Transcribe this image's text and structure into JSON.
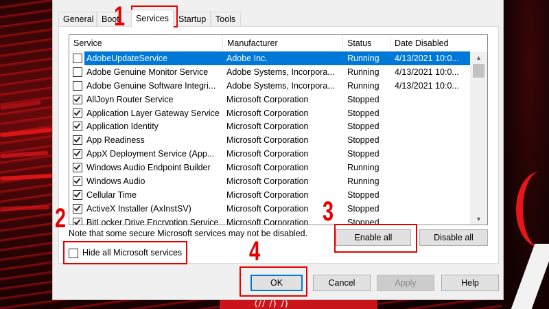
{
  "tabs": [
    {
      "label": "General"
    },
    {
      "label": "Boot"
    },
    {
      "label": "Services"
    },
    {
      "label": "Startup"
    },
    {
      "label": "Tools"
    }
  ],
  "columns": {
    "service": "Service",
    "manufacturer": "Manufacturer",
    "status": "Status",
    "date_disabled": "Date Disabled"
  },
  "services": [
    {
      "name": "AdobeUpdateService",
      "manufacturer": "Adobe Inc.",
      "status": "Running",
      "date": "4/13/2021 10:0...",
      "checked": false,
      "selected": true
    },
    {
      "name": "Adobe Genuine Monitor Service",
      "manufacturer": "Adobe Systems, Incorpora...",
      "status": "Running",
      "date": "4/13/2021 10:0...",
      "checked": false
    },
    {
      "name": "Adobe Genuine Software Integri...",
      "manufacturer": "Adobe Systems, Incorpora...",
      "status": "Running",
      "date": "4/13/2021 10:0...",
      "checked": false
    },
    {
      "name": "AllJoyn Router Service",
      "manufacturer": "Microsoft Corporation",
      "status": "Stopped",
      "date": "",
      "checked": true
    },
    {
      "name": "Application Layer Gateway Service",
      "manufacturer": "Microsoft Corporation",
      "status": "Stopped",
      "date": "",
      "checked": true
    },
    {
      "name": "Application Identity",
      "manufacturer": "Microsoft Corporation",
      "status": "Stopped",
      "date": "",
      "checked": true
    },
    {
      "name": "App Readiness",
      "manufacturer": "Microsoft Corporation",
      "status": "Stopped",
      "date": "",
      "checked": true
    },
    {
      "name": "AppX Deployment Service (App...",
      "manufacturer": "Microsoft Corporation",
      "status": "Stopped",
      "date": "",
      "checked": true
    },
    {
      "name": "Windows Audio Endpoint Builder",
      "manufacturer": "Microsoft Corporation",
      "status": "Running",
      "date": "",
      "checked": true
    },
    {
      "name": "Windows Audio",
      "manufacturer": "Microsoft Corporation",
      "status": "Running",
      "date": "",
      "checked": true
    },
    {
      "name": "Cellular Time",
      "manufacturer": "Microsoft Corporation",
      "status": "Stopped",
      "date": "",
      "checked": true
    },
    {
      "name": "ActiveX Installer (AxInstSV)",
      "manufacturer": "Microsoft Corporation",
      "status": "Stopped",
      "date": "",
      "checked": true
    },
    {
      "name": "BitLocker Drive Encryption Service",
      "manufacturer": "Microsoft Corporation",
      "status": "Stopped",
      "date": "",
      "checked": true
    }
  ],
  "note": "Note that some secure Microsoft services may not be disabled.",
  "enable_all": "Enable all",
  "disable_all": "Disable all",
  "hide_ms_label": "Hide all Microsoft services",
  "hide_ms_checked": false,
  "buttons": {
    "ok": "OK",
    "cancel": "Cancel",
    "apply": "Apply",
    "help": "Help"
  },
  "annotations": [
    "1",
    "2",
    "3",
    "4"
  ],
  "colors": {
    "selection": "#0078d7",
    "annotation": "#e50000"
  }
}
